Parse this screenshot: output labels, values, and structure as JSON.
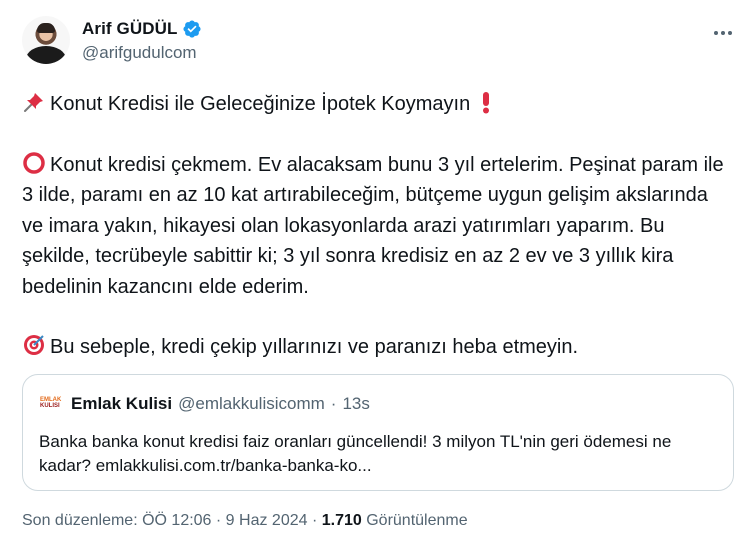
{
  "author": {
    "name": "Arif GÜDÜL",
    "handle": "@arifgudulcom",
    "verified": true
  },
  "more_icon": "ellipsis-icon",
  "tweet": {
    "title": "Konut Kredisi ile Geleceğinize İpotek Koymayın",
    "title_emoji_start": "pushpin-icon",
    "title_emoji_end": "exclamation-icon",
    "paragraph_1": "Konut kredisi çekmem. Ev alacaksam bunu 3 yıl ertelerim. Peşinat param ile 3 ilde, paramı en az 10 kat artırabileceğim, bütçeme uygun gelişim akslarında ve imara yakın, hikayesi olan lokasyonlarda arazi yatırımları yaparım. Bu şekilde, tecrübeyle sabittir ki; 3 yıl sonra kredisiz en az 2 ev ve 3 yıllık kira bedelinin kazancını elde ederim.",
    "paragraph_1_emoji": "red-circle-icon",
    "paragraph_2": "Bu sebeple, kredi çekip yıllarınızı ve paranızı heba etmeyin.",
    "paragraph_2_emoji": "target-icon"
  },
  "quoted": {
    "name": "Emlak Kulisi",
    "handle": "@emlakkulisicomm",
    "separator": "·",
    "time": "13s",
    "logo_line1": "EMLAK",
    "logo_line2": "KULISI",
    "text": "Banka banka konut kredisi faiz oranları güncellendi! 3 milyon TL'nin geri ödemesi ne kadar? emlakkulisi.com.tr/banka-banka-ko..."
  },
  "meta": {
    "edited_label": "Son düzenleme: ÖÖ 12:06",
    "separator1": " · ",
    "date": "9 Haz 2024",
    "separator2": " · ",
    "views_count": "1.710",
    "views_label": "Görüntülenme"
  },
  "colors": {
    "text": "#0f1419",
    "secondary": "#536471",
    "border": "#cfd9de",
    "verified": "#1d9bf0",
    "red": "#e0245e"
  }
}
